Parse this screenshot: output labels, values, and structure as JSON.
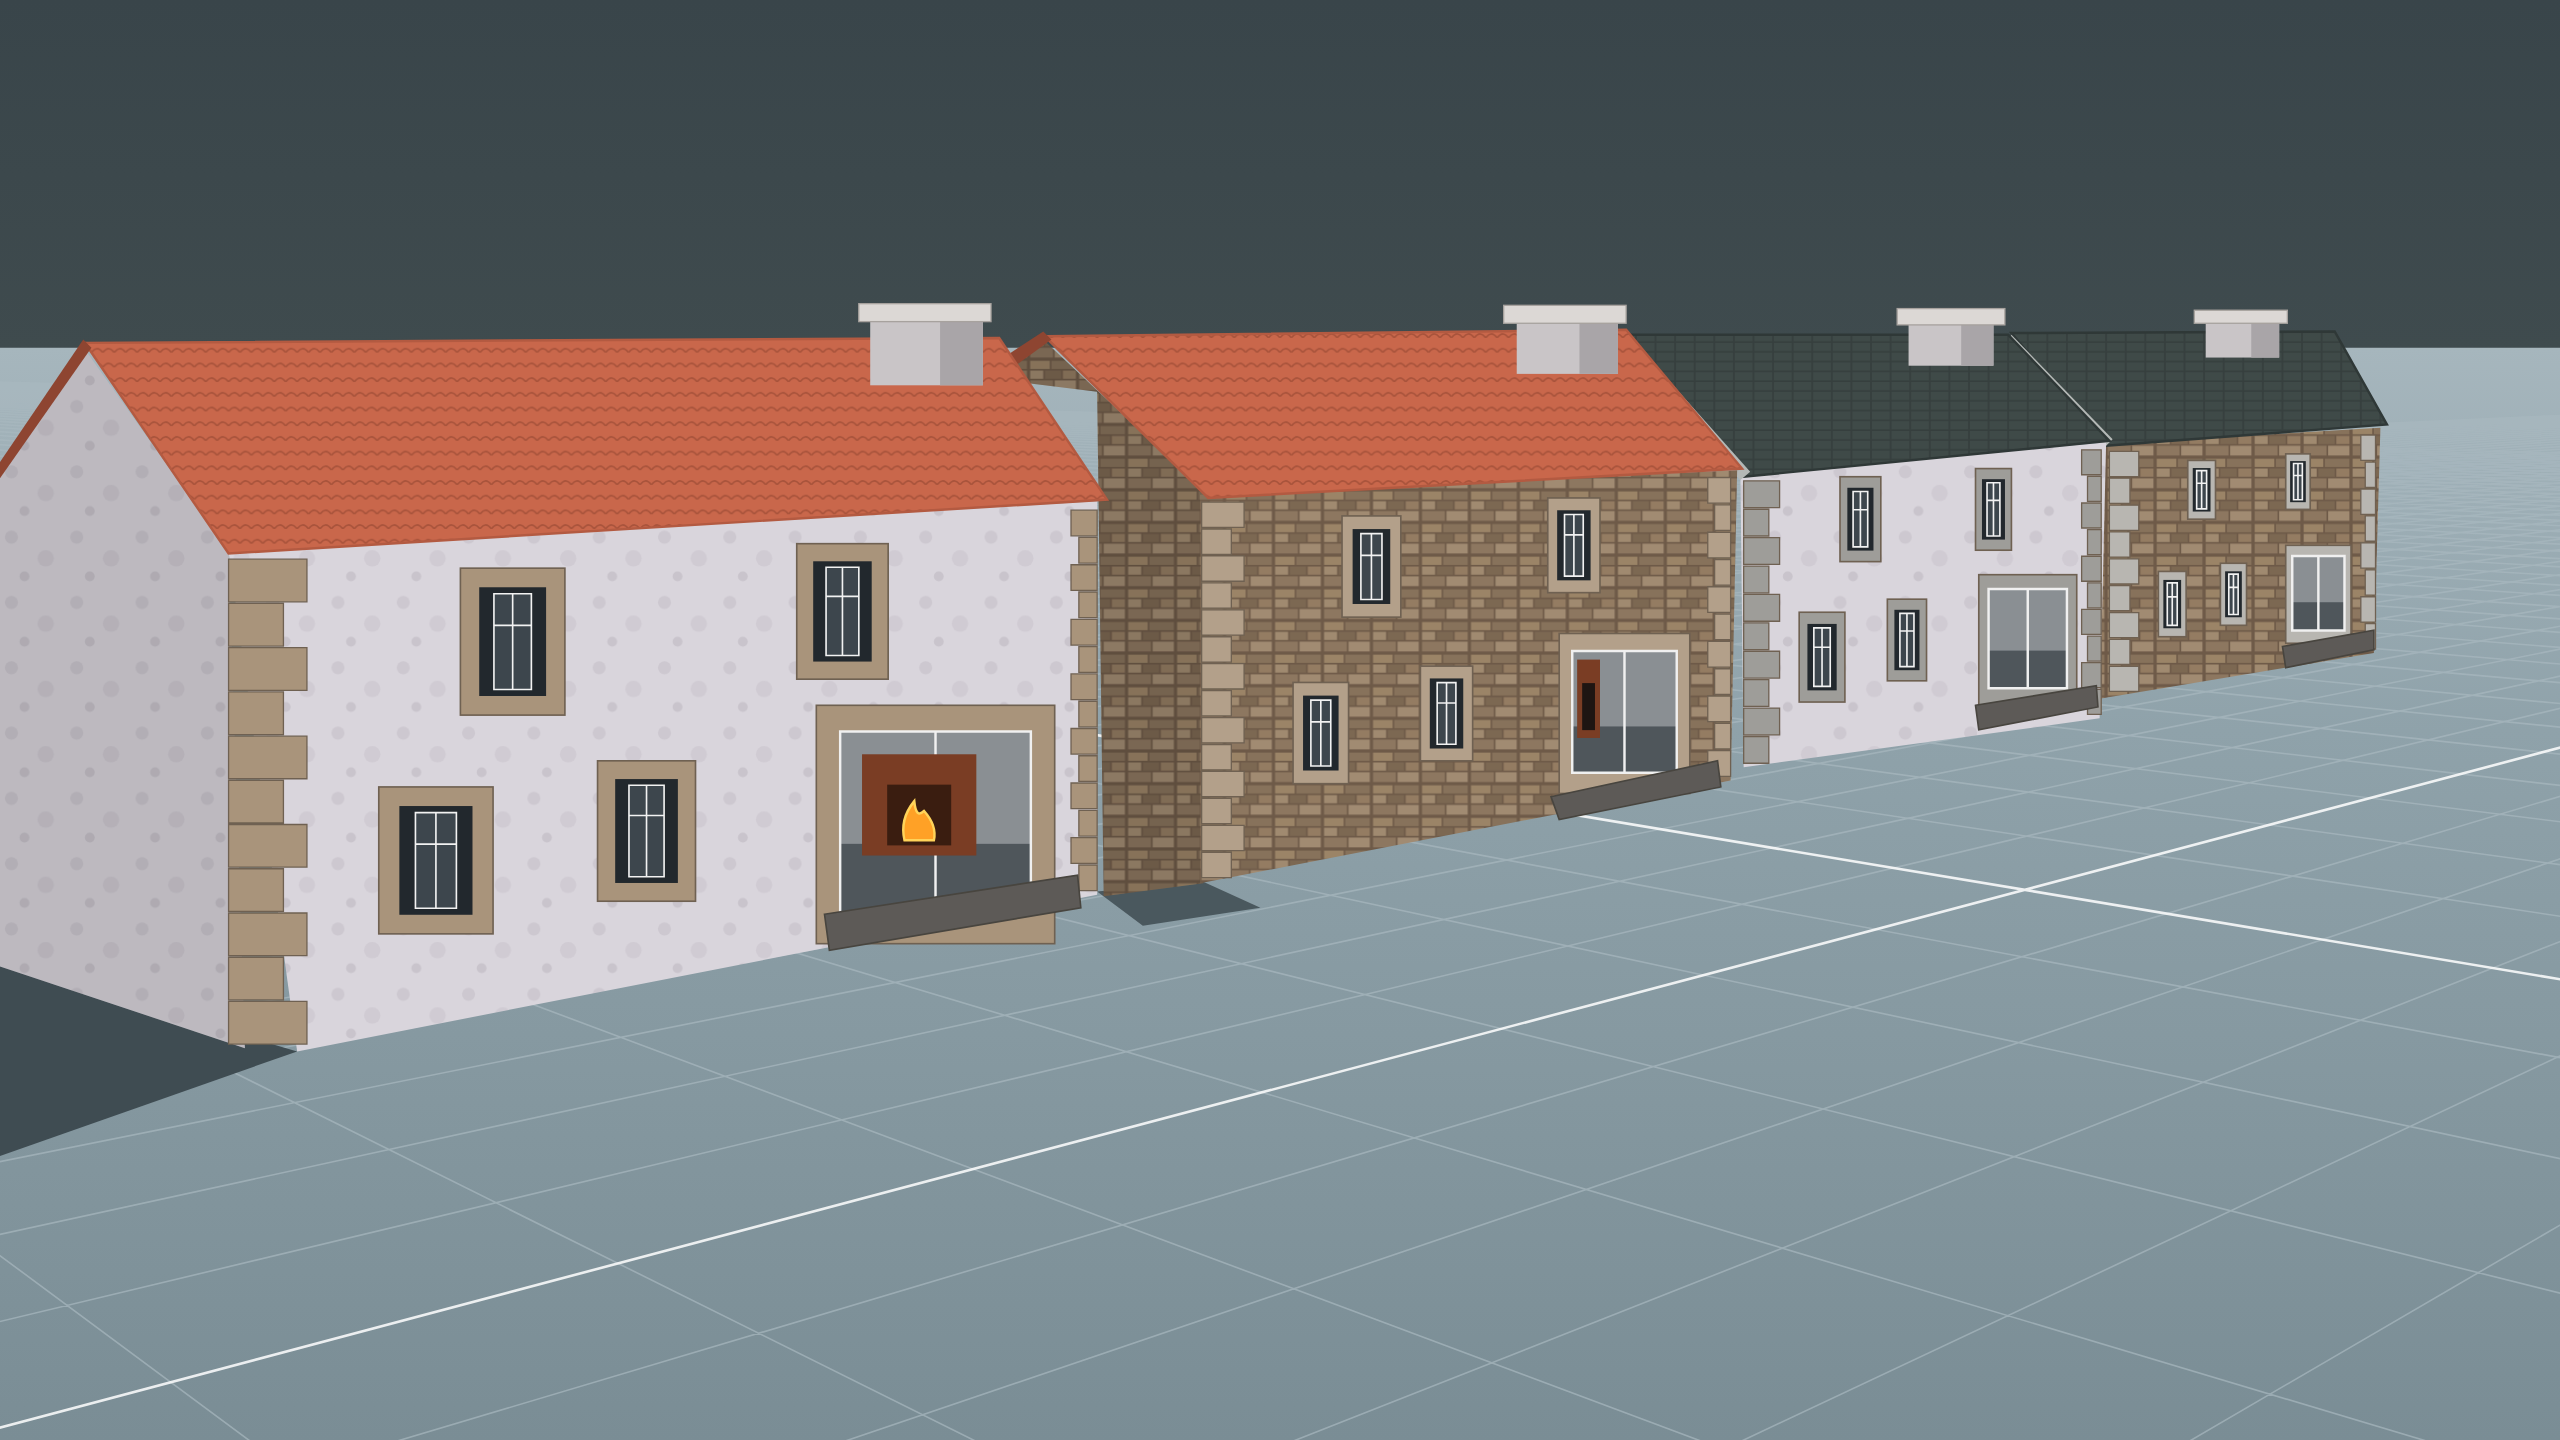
{
  "houses": [
    {
      "kind": "plaster",
      "roof": {
        "kind": "terracotta"
      },
      "fireplace": {
        "lit": true
      }
    },
    {
      "kind": "stone",
      "roof": {
        "kind": "terracotta"
      },
      "fireplace": {
        "lit": false
      }
    },
    {
      "kind": "plaster",
      "roof": {
        "kind": "slate"
      }
    },
    {
      "kind": "stone",
      "roof": {
        "kind": "slate"
      }
    }
  ]
}
